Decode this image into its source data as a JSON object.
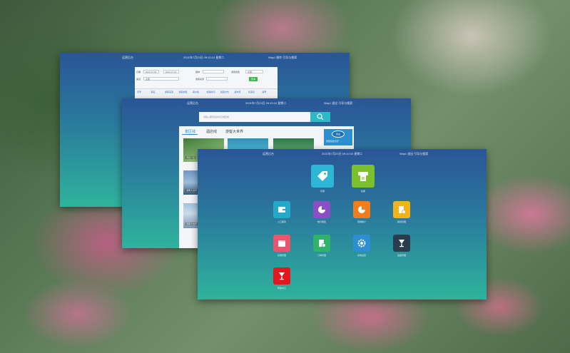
{
  "window_back": {
    "topbar": {
      "brand": "运营后台",
      "clock": "2021年7月23日 09:10:10  星期二",
      "user": "Way1  操作  引导与搜索"
    },
    "form": {
      "date_label": "日期",
      "date_from": "2021-07-01",
      "date_to": "2021-07-31",
      "field2_label": "票种",
      "field3_label": "游客类型",
      "field3_value": "全部",
      "field4_label": "渠道",
      "field4_value": "全部",
      "field5_label": "游客来源",
      "submit_label": "查询"
    },
    "columns": [
      "序号",
      "票名",
      "游客来源",
      "游客类型",
      "票价格",
      "检票时间",
      "检票方式",
      "操作员",
      "售票员",
      "票号"
    ]
  },
  "window_mid": {
    "topbar": {
      "brand": "运营后台",
      "clock": "2021年7月23日 09:10:10  星期二",
      "user": "Way1  退出  引导与搜索"
    },
    "search": {
      "placeholder": "请输入要查找的景点或套餐"
    },
    "tabs": [
      "景区线",
      "酒店线",
      "游客大世界"
    ],
    "captions": [
      "景区介绍",
      "游客大世界",
      "游客大世界"
    ],
    "badge": {
      "logo": "欢迎",
      "text": "景区综合大厅"
    }
  },
  "window_front": {
    "topbar": {
      "brand": "运营后台",
      "clock": "2021年7月23日 09:10:10  星期二",
      "user": "Way1  退出  引导与搜索"
    },
    "tiles": [
      {
        "label": "售票",
        "icon": "tag-icon",
        "color": "#2db6d6"
      },
      {
        "label": "检票",
        "icon": "ticket-machine-icon",
        "color": "#7cc02a"
      },
      {
        "label": "入口票务",
        "icon": "wallet-icon",
        "color": "#24a9c9"
      },
      {
        "label": "统计报表",
        "icon": "pie-chart-icon",
        "color": "#8a4fc7"
      },
      {
        "label": "营销统计",
        "icon": "pie-chart-icon",
        "color": "#ef7d1e"
      },
      {
        "label": "票务管理",
        "icon": "document-settings-icon",
        "color": "#f2b319"
      },
      {
        "label": "系统管理",
        "icon": "calendar-icon",
        "color": "#e8556c"
      },
      {
        "label": "订单管理",
        "icon": "document-settings-icon",
        "color": "#2fb36b"
      },
      {
        "label": "系统设置",
        "icon": "gear-icon",
        "color": "#2c8fd3"
      },
      {
        "label": "设备管理",
        "icon": "cup-icon",
        "color": "#2a3d4f"
      },
      {
        "label": "帮助中心",
        "icon": "cup-icon",
        "color": "#e5171e"
      }
    ]
  }
}
